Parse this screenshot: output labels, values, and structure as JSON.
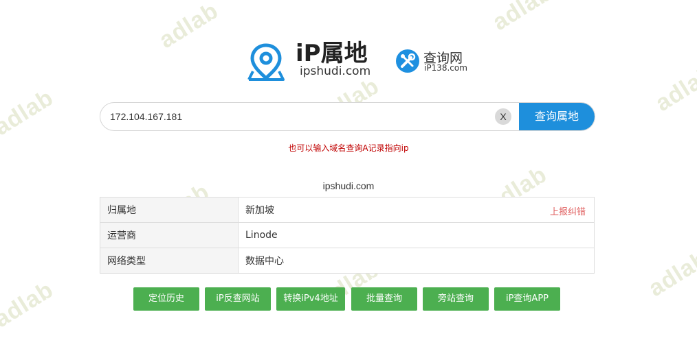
{
  "watermark": "adlab",
  "logo_main": {
    "title": "iP属地",
    "domain": "ipshudi.com"
  },
  "logo_second": {
    "name": "查询网",
    "sub": "iP138.com"
  },
  "search": {
    "value": "172.104.167.181",
    "clear_label": "X",
    "button_label": "查询属地"
  },
  "hint": "也可以输入域名查询A记录指向ip",
  "result": {
    "domain": "ipshudi.com",
    "report_label": "上报纠错",
    "rows": [
      {
        "key": "归属地",
        "value": "新加坡"
      },
      {
        "key": "运营商",
        "value": "Linode"
      },
      {
        "key": "网络类型",
        "value": "数据中心"
      }
    ]
  },
  "actions": [
    "定位历史",
    "iP反查网站",
    "转换iPv4地址",
    "批量查询",
    "旁站查询",
    "iP查询APP"
  ],
  "colors": {
    "accent": "#1e8fdc",
    "green": "#4caf50",
    "error": "#c00000",
    "report": "#e06060"
  },
  "icons": {
    "logo_main": "location-pin-icon",
    "logo_second": "tools-icon"
  }
}
